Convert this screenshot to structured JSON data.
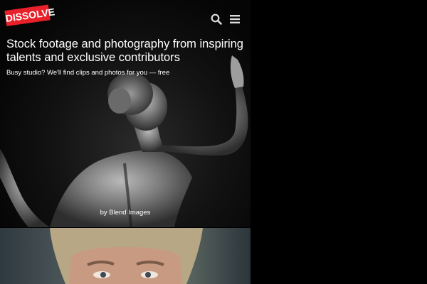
{
  "brand": {
    "logo_text": "DISSOLVE",
    "logo_color": "#e8202a"
  },
  "header": {
    "search_icon": "search-icon",
    "menu_icon": "hamburger-menu-icon"
  },
  "hero": {
    "headline": "Stock footage and photography from inspiring talents and exclusive contributors",
    "subline": "Busy studio? We'll find clips and photos for you — free",
    "credit": "by Blend Images"
  },
  "colors": {
    "background": "#000000",
    "text": "#ffffff"
  }
}
